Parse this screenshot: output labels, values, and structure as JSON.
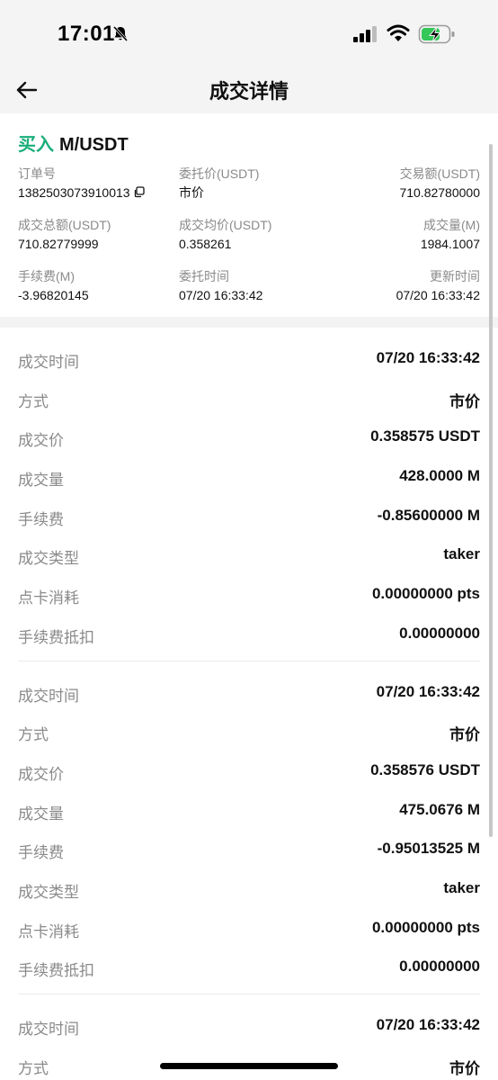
{
  "status": {
    "time": "17:01",
    "icons": [
      "bell-muted-icon",
      "signal-icon",
      "wifi-icon",
      "battery-charging-icon"
    ],
    "battery_color": "#34c759"
  },
  "nav": {
    "back_icon": "arrow-left-icon",
    "title": "成交详情"
  },
  "order": {
    "side": "买入",
    "side_color": "#1bae7a",
    "pair": "M/USDT",
    "fields": [
      [
        {
          "label": "订单号",
          "value": "1382503073910013"
        },
        {
          "label": "委托价(USDT)",
          "value": "市价"
        },
        {
          "label": "交易额(USDT)",
          "value": "710.82780000"
        }
      ],
      [
        {
          "label": "成交总额(USDT)",
          "value": "710.82779999"
        },
        {
          "label": "成交均价(USDT)",
          "value": "0.358261"
        },
        {
          "label": "成交量(M)",
          "value": "1984.1007"
        }
      ],
      [
        {
          "label": "手续费(M)",
          "value": "-3.96820145"
        },
        {
          "label": "委托时间",
          "value": "07/20 16:33:42"
        },
        {
          "label": "更新时间",
          "value": "07/20 16:33:42"
        }
      ]
    ]
  },
  "fills": [
    [
      {
        "label": "成交时间",
        "value": "07/20 16:33:42"
      },
      {
        "label": "方式",
        "value": "市价"
      },
      {
        "label": "成交价",
        "value": "0.358575 USDT"
      },
      {
        "label": "成交量",
        "value": "428.0000 M"
      },
      {
        "label": "手续费",
        "value": "-0.85600000 M"
      },
      {
        "label": "成交类型",
        "value": "taker"
      },
      {
        "label": "点卡消耗",
        "value": "0.00000000 pts"
      },
      {
        "label": "手续费抵扣",
        "value": "0.00000000"
      }
    ],
    [
      {
        "label": "成交时间",
        "value": "07/20 16:33:42"
      },
      {
        "label": "方式",
        "value": "市价"
      },
      {
        "label": "成交价",
        "value": "0.358576 USDT"
      },
      {
        "label": "成交量",
        "value": "475.0676 M"
      },
      {
        "label": "手续费",
        "value": "-0.95013525 M"
      },
      {
        "label": "成交类型",
        "value": "taker"
      },
      {
        "label": "点卡消耗",
        "value": "0.00000000 pts"
      },
      {
        "label": "手续费抵扣",
        "value": "0.00000000"
      }
    ],
    [
      {
        "label": "成交时间",
        "value": "07/20 16:33:42"
      },
      {
        "label": "方式",
        "value": "市价"
      }
    ]
  ]
}
